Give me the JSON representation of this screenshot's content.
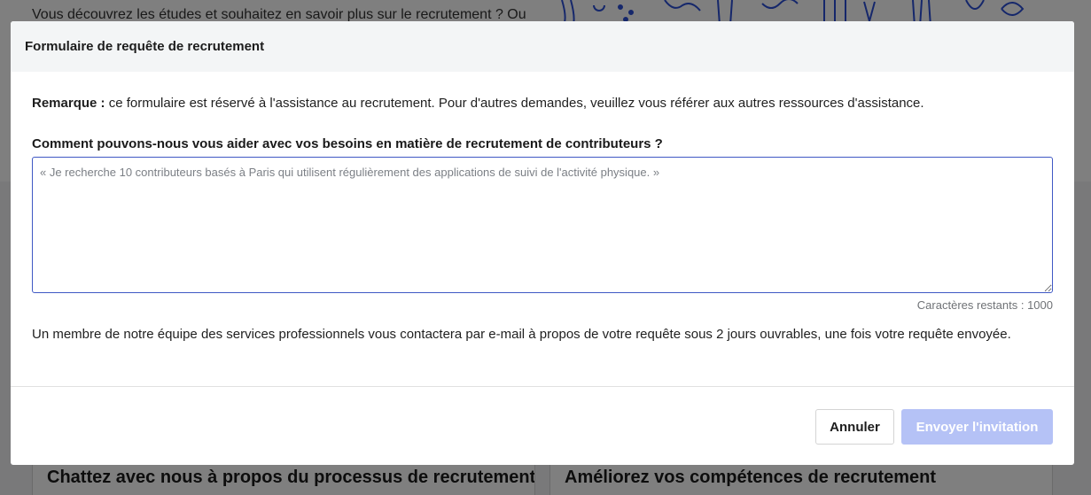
{
  "background": {
    "intro_text": "Vous découvrez les études et souhaitez en savoir plus sur le recrutement ? Ou",
    "card_chat_title": "Chattez avec nous à propos du processus de recrutement",
    "card_skills_title": "Améliorez vos compétences de recrutement"
  },
  "modal": {
    "title": "Formulaire de requête de recrutement",
    "note_label": "Remarque :",
    "note_text": " ce formulaire est réservé à l'assistance au recrutement. Pour d'autres demandes, veuillez vous référer aux autres ressources d'assistance.",
    "question": "Comment pouvons-nous vous aider avec vos besoins en matière de recrutement de contributeurs ?",
    "textarea_placeholder": "« Je recherche 10 contributeurs basés à Paris qui utilisent régulièrement des applications de suivi de l'activité physique. »",
    "textarea_value": "",
    "counter": "Caractères restants : 1000",
    "contact_note": "Un membre de notre équipe des services professionnels vous contactera par e-mail à propos de votre requête sous 2 jours ouvrables, une fois votre requête envoyée.",
    "cancel_label": "Annuler",
    "send_label": "Envoyer l'invitation"
  },
  "colors": {
    "accent_border": "#3f58c4",
    "send_disabled": "#b5c2f6",
    "header_bg": "#f3f5f6",
    "illustration_blue": "#2b4fd6"
  },
  "icons": {
    "illustration": "decorative-illustration"
  }
}
